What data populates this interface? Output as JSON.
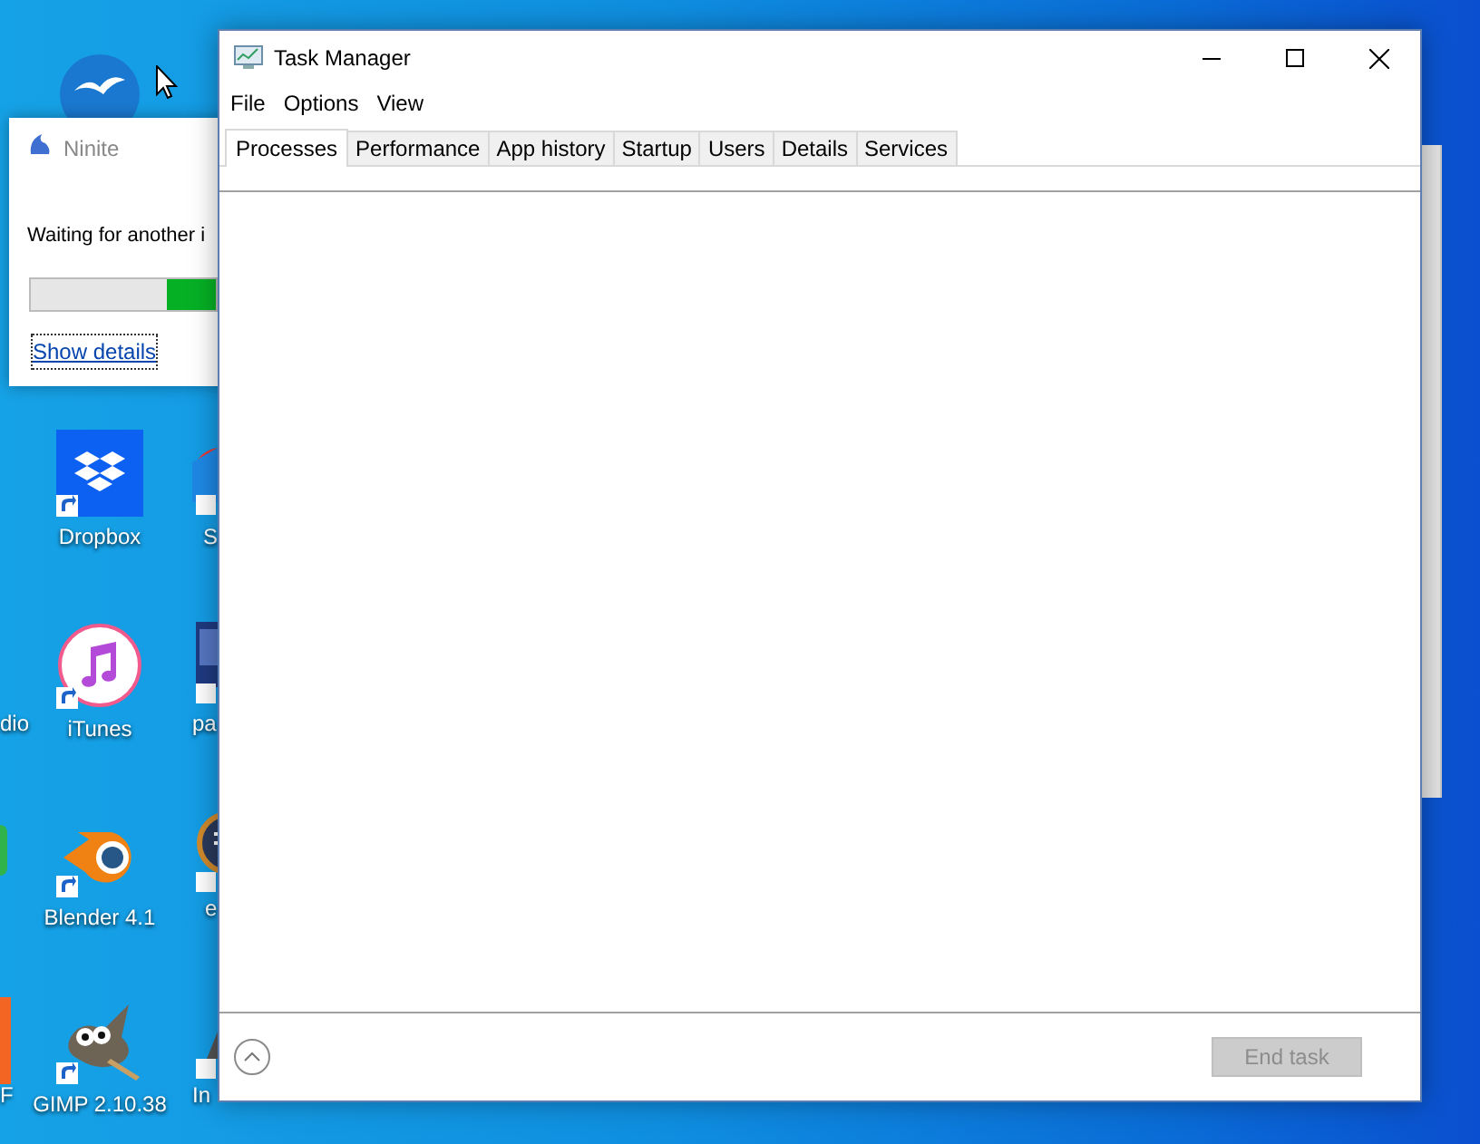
{
  "desktop": {
    "icons": [
      {
        "label": "Dropbox"
      },
      {
        "label": "iTunes"
      },
      {
        "label": "Blender 4.1"
      },
      {
        "label": "GIMP 2.10.38"
      }
    ],
    "cut_labels": [
      "dio",
      "F",
      "S",
      "pa",
      "e",
      "In"
    ]
  },
  "ninite": {
    "title": "Ninite",
    "message": "Waiting for another i",
    "progress": {
      "level": 0.26
    },
    "link": "Show details"
  },
  "task_manager": {
    "title": "Task Manager",
    "menu": [
      "File",
      "Options",
      "View"
    ],
    "tabs": [
      {
        "label": "Processes",
        "selected": true
      },
      {
        "label": "Performance",
        "selected": false
      },
      {
        "label": "App history",
        "selected": false
      },
      {
        "label": "Startup",
        "selected": false
      },
      {
        "label": "Users",
        "selected": false
      },
      {
        "label": "Details",
        "selected": false
      },
      {
        "label": "Services",
        "selected": false
      }
    ],
    "end_task": {
      "label": "End task",
      "disabled": true
    }
  }
}
